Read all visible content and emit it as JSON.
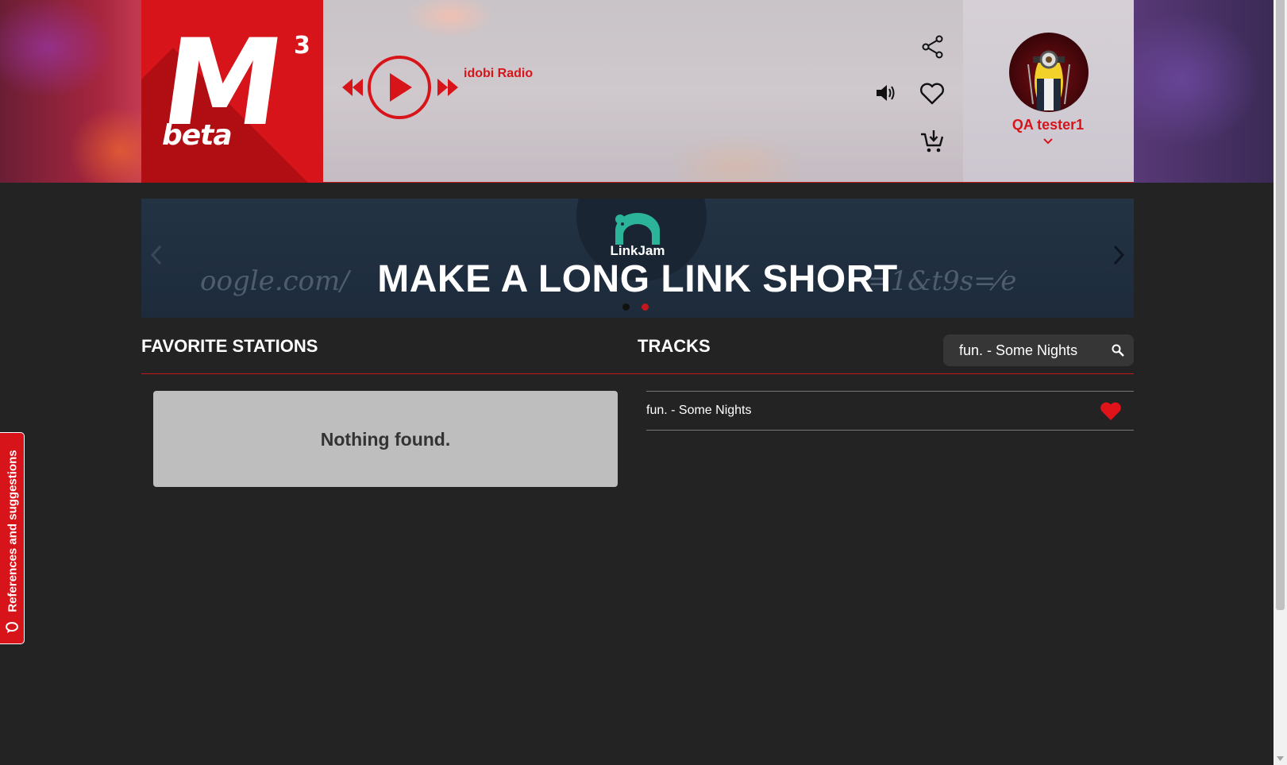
{
  "logo": {
    "mark": "M",
    "superscript": "3",
    "tag": "beta"
  },
  "player": {
    "station_name": "idobi Radio"
  },
  "user": {
    "name": "QA tester1"
  },
  "banner": {
    "brand": "LinkJam",
    "headline": "MAKE A LONG LINK SHORT",
    "deco_left": "oogle.com/",
    "deco_right": "=1&t9s=⁄e",
    "slides": 2,
    "active_slide": 2
  },
  "favorites": {
    "title": "FAVORITE STATIONS",
    "empty_text": "Nothing found."
  },
  "tracks": {
    "title": "TRACKS",
    "search_value": "fun. - Some Nights",
    "items": [
      {
        "title": "fun. - Some Nights",
        "favorited": true
      }
    ]
  },
  "feedback": {
    "label": "References and suggestions"
  },
  "colors": {
    "accent": "#d8141b",
    "background": "#232323"
  }
}
